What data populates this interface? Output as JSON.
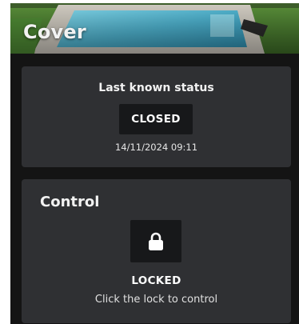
{
  "header": {
    "title": "Cover"
  },
  "status_card": {
    "heading": "Last known status",
    "status": "CLOSED",
    "timestamp": "14/11/2024 09:11"
  },
  "control_card": {
    "title": "Control",
    "lock_icon": "padlock-icon",
    "lock_state": "LOCKED",
    "hint": "Click the lock to control"
  },
  "colors": {
    "background": "#141414",
    "card": "#2f3033",
    "button": "#17181a",
    "text": "#ffffff"
  }
}
